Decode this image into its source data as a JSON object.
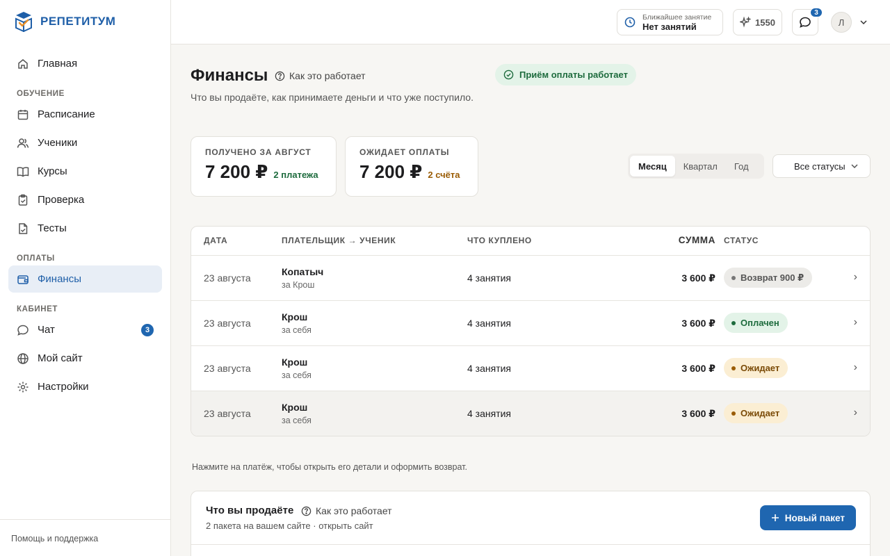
{
  "brand": {
    "name": "РЕПЕТИТУМ"
  },
  "sidebar": {
    "items": [
      {
        "label": "Главная",
        "icon": "home-icon"
      }
    ],
    "sections": [
      {
        "title": "ОБУЧЕНИЕ",
        "items": [
          {
            "label": "Расписание",
            "icon": "calendar-icon"
          },
          {
            "label": "Ученики",
            "icon": "users-icon"
          },
          {
            "label": "Курсы",
            "icon": "book-icon"
          },
          {
            "label": "Проверка",
            "icon": "clipboard-icon"
          },
          {
            "label": "Тесты",
            "icon": "test-icon"
          }
        ]
      },
      {
        "title": "ОПЛАТЫ",
        "items": [
          {
            "label": "Финансы",
            "icon": "wallet-icon",
            "active": true
          }
        ]
      },
      {
        "title": "КАБИНЕТ",
        "items": [
          {
            "label": "Чат",
            "icon": "chat-icon",
            "badge": "3"
          },
          {
            "label": "Мой сайт",
            "icon": "globe-icon"
          },
          {
            "label": "Настройки",
            "icon": "gear-icon"
          }
        ]
      }
    ],
    "footer": "Помощь и поддержка"
  },
  "topbar": {
    "next_lesson_label": "Ближайшее занятие",
    "next_lesson_value": "Нет занятий",
    "points": "1550",
    "chat_badge": "3",
    "avatar_initial": "Л"
  },
  "header": {
    "title": "Финансы",
    "how_link": "Как это работает",
    "payment_status": "Приём оплаты работает",
    "subtitle": "Что вы продаёте, как принимаете деньги и что уже поступило."
  },
  "summary": {
    "received": {
      "label": "ПОЛУЧЕНО ЗА АВГУСТ",
      "value": "7 200 ₽",
      "note": "2 платежа"
    },
    "pending": {
      "label": "ОЖИДАЕТ ОПЛАТЫ",
      "value": "7 200 ₽",
      "note": "2 счёта"
    }
  },
  "filters": {
    "periods": [
      "Месяц",
      "Квартал",
      "Год"
    ],
    "selected_period": "Месяц",
    "status_select": "Все статусы"
  },
  "table": {
    "headers": {
      "date": "ДАТА",
      "payer": "ПЛАТЕЛЬЩИК → УЧЕНИК",
      "item": "ЧТО КУПЛЕНО",
      "sum": "СУММА",
      "status": "СТАТУС"
    },
    "rows": [
      {
        "date": "23 августа",
        "payer": "Копатыч",
        "payer_sub": "за Крош",
        "item": "4 занятия",
        "sum": "3 600 ₽",
        "status": "Возврат 900 ₽",
        "status_kind": "refund"
      },
      {
        "date": "23 августа",
        "payer": "Крош",
        "payer_sub": "за себя",
        "item": "4 занятия",
        "sum": "3 600 ₽",
        "status": "Оплачен",
        "status_kind": "paid"
      },
      {
        "date": "23 августа",
        "payer": "Крош",
        "payer_sub": "за себя",
        "item": "4 занятия",
        "sum": "3 600 ₽",
        "status": "Ожидает",
        "status_kind": "pending"
      },
      {
        "date": "23 августа",
        "payer": "Крош",
        "payer_sub": "за себя",
        "item": "4 занятия",
        "sum": "3 600 ₽",
        "status": "Ожидает",
        "status_kind": "pending"
      }
    ]
  },
  "hint": "Нажмите на платёж, чтобы открыть его детали и оформить возврат.",
  "products": {
    "title": "Что вы продаёте",
    "how_link": "Как это работает",
    "subtitle": "2 пакета на вашем сайте · открыть сайт",
    "new_button": "Новый пакет"
  },
  "colors": {
    "accent": "#1f66b0",
    "paid_bg": "#e3f3e8",
    "paid_fg": "#1d6b3d",
    "pending_bg": "#fbeed3",
    "pending_fg": "#7a4a06",
    "refund_bg": "#ecebe8",
    "refund_fg": "#555555"
  }
}
